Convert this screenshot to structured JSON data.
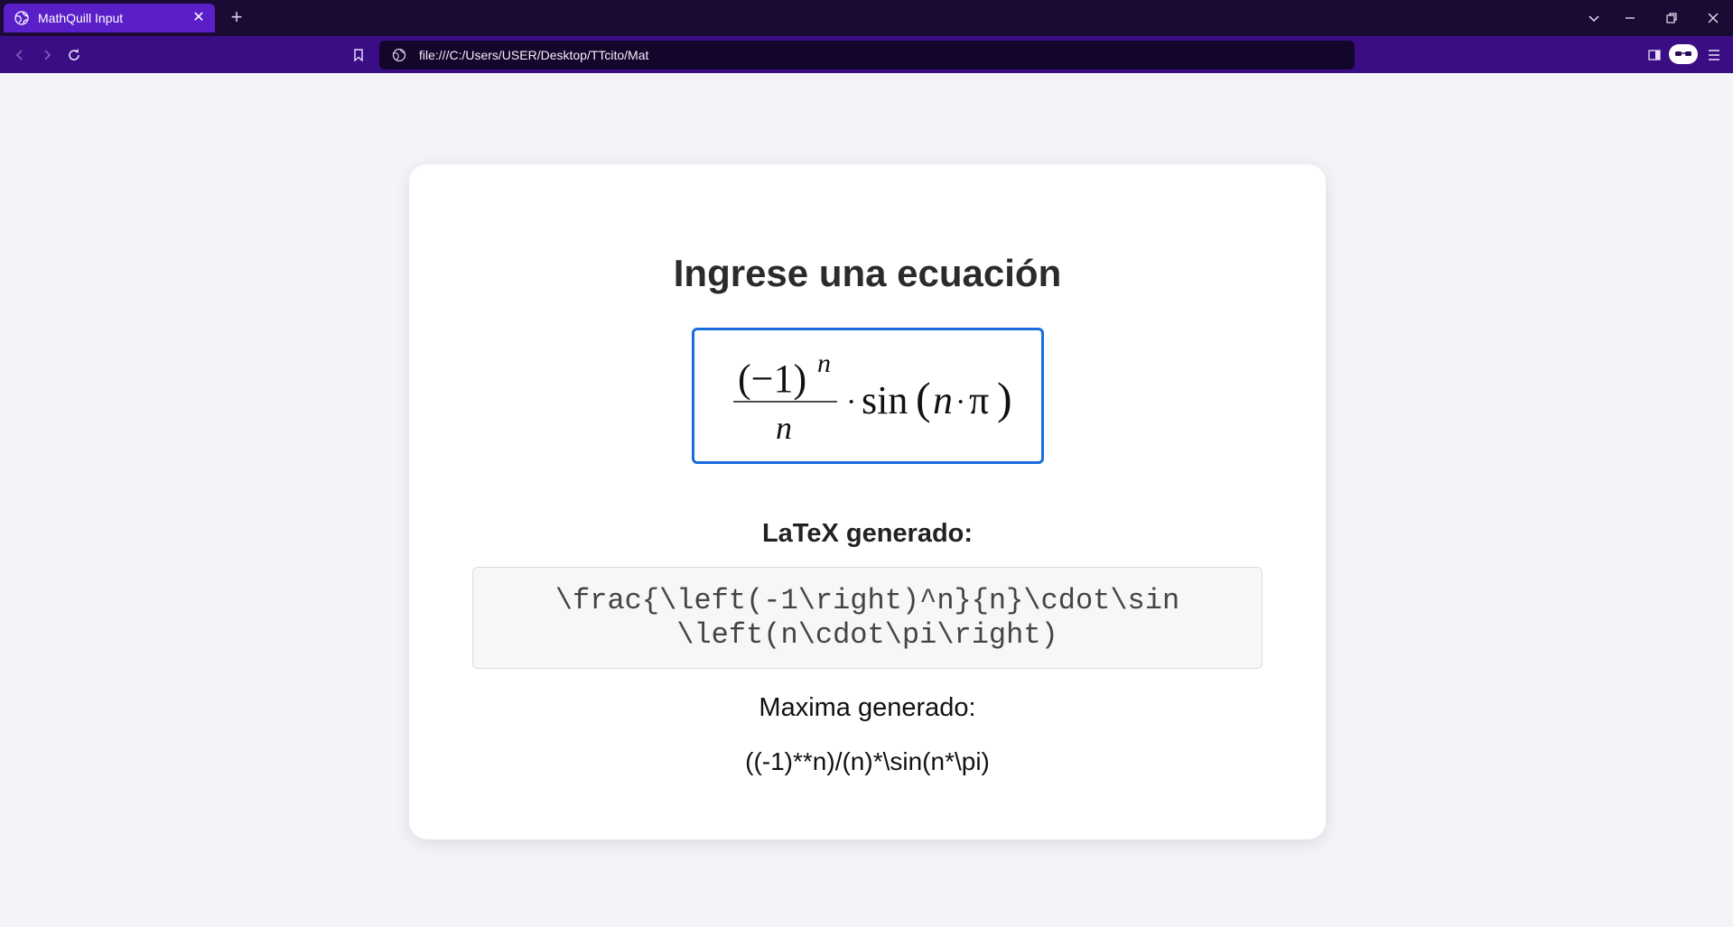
{
  "browser": {
    "tab_title": "MathQuill Input",
    "tab_close_glyph": "✕",
    "new_tab_glyph": "+",
    "url": "file:///C:/Users/USER/Desktop/TTcito/Mat",
    "icons": {
      "tab_favicon": "globe-icon",
      "tab_list": "chevron-down-icon",
      "minimize": "minimize-icon",
      "restore": "restore-icon",
      "close": "close-icon",
      "back": "back-arrow-icon",
      "forward": "forward-arrow-icon",
      "reload": "reload-icon",
      "bookmark": "bookmark-icon",
      "site_info": "site-info-icon",
      "sidebar": "sidebar-icon",
      "reader_mode": "reader-glasses-icon",
      "menu": "hamburger-menu-icon"
    },
    "colors": {
      "tabbar": "#1b0a33",
      "active_tab": "#5b1fc9",
      "navbar": "#3a0d85",
      "urlbar": "#14062a"
    }
  },
  "page": {
    "title": "Ingrese una ecuación",
    "math_field": {
      "numerator_base": "(−1)",
      "numerator_exponent": "n",
      "denominator": "n",
      "cdot": "·",
      "function": "sin",
      "open_paren": "(",
      "arg_var": "n",
      "arg_cdot": "·",
      "arg_pi": "π",
      "close_paren": ")",
      "border_color": "#1a6ce0"
    },
    "latex_label": "LaTeX generado:",
    "latex_output": "\\frac{\\left(-1\\right)^n}{n}\\cdot\\sin\\left(n\\cdot\\pi\\right)",
    "maxima_label": "Maxima generado:",
    "maxima_output": "((-1)**n)/(n)*\\sin(n*\\pi)",
    "background": "#f4f4f8"
  }
}
